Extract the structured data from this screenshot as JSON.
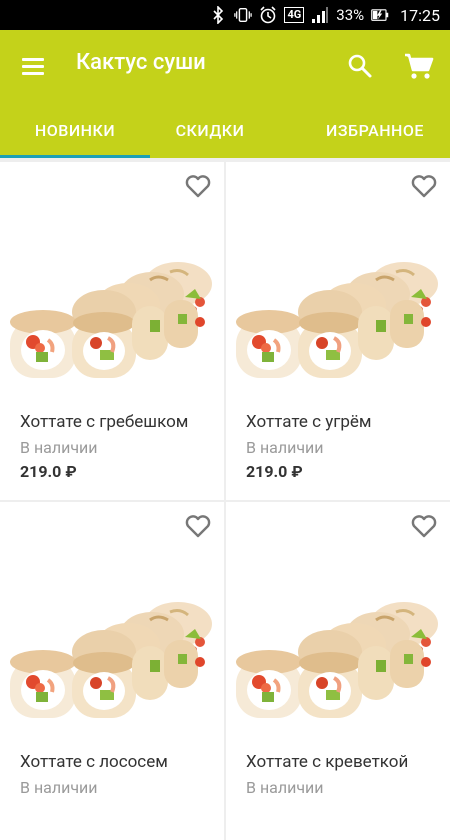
{
  "status_bar": {
    "battery": "33%",
    "time": "17:25",
    "network": "4G"
  },
  "app_bar": {
    "title": "Кактус суши"
  },
  "tabs": [
    {
      "label": "НОВИНКИ",
      "selected": true
    },
    {
      "label": "СКИДКИ",
      "selected": false
    },
    {
      "label": "ИЗБРАННОЕ",
      "selected": false
    }
  ],
  "products": [
    {
      "name": "Хоттате с гребешком",
      "stock": "В наличии",
      "price": "219.0 ₽"
    },
    {
      "name": "Хоттате с угрём",
      "stock": "В наличии",
      "price": "219.0 ₽"
    },
    {
      "name": "Хоттате с лососем",
      "stock": "В наличии",
      "price": ""
    },
    {
      "name": "Хоттате с креветкой",
      "stock": "В наличии",
      "price": ""
    }
  ],
  "colors": {
    "accent": "#c4d21a",
    "tab_indicator": "#1ba0b5",
    "background": "#eeeeee"
  },
  "icons": [
    "bluetooth-icon",
    "vibrate-icon",
    "alarm-icon",
    "signal-icon",
    "battery-charging-icon",
    "menu-icon",
    "search-icon",
    "cart-icon",
    "heart-outline-icon"
  ]
}
